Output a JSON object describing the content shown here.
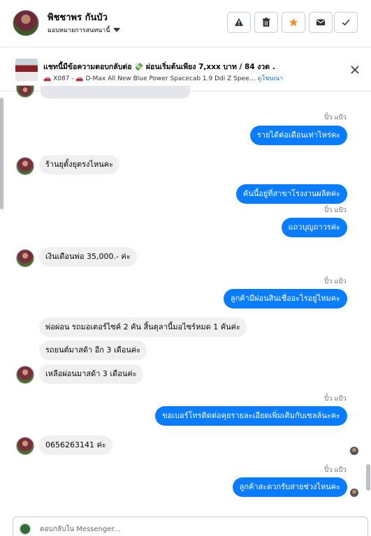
{
  "header": {
    "contact_name": "พิชชาพร กันบัว",
    "assign_label": "มอบหมายการสนทนานี้",
    "actions": [
      {
        "icon": "warning-icon"
      },
      {
        "icon": "trash-icon"
      },
      {
        "icon": "star-icon",
        "color": "#f28c28"
      },
      {
        "icon": "mail-icon"
      },
      {
        "icon": "check-icon"
      }
    ]
  },
  "ad_banner": {
    "title": "แชทนี้มีข้อความตอบกลับต่อ 💸 ผ่อนเริ่มต้นเพียง 7,xxx บาท / 84 งวด .",
    "subtitle": "🚗 X087 - 🚗 D-Max All New Blue Power Spacecab 1.9 Ddi Z Spee…",
    "link": "ดูโฆษณา"
  },
  "messages": [
    {
      "dir": "out",
      "sender": "ปิ๋ว แป้ว",
      "text": "รายได้ต่อเดือนเท่าไหร่คะ"
    },
    {
      "dir": "in",
      "text": "ร้านยุตั้งยุตรงไหนคะ"
    },
    {
      "dir": "out",
      "text": "คันนี้อยู่ที่สาขาโรงงานผลิตค่ะ"
    },
    {
      "dir": "out",
      "sender": "ปิ๋ว แป้ว",
      "text": "แถวบุญถาวรค่ะ"
    },
    {
      "dir": "in",
      "text": "เงินเดือนพ่อ 35,000.- ค่ะ"
    },
    {
      "dir": "out",
      "sender": "ปิ๋ว แป้ว",
      "text": "ลูกค้ามีผ่อนสินเชื่ออะไรอยู่ไหมคะ"
    },
    {
      "dir": "in",
      "text": "พ่อผ่อน รถมอเตอร์ไซค์ 2 คัน สิ้นตุลานี้มอไซร์หมด 1 คันค่ะ"
    },
    {
      "dir": "in",
      "text": "รถยนต์มาสด้า อีก 3 เดือนค่ะ"
    },
    {
      "dir": "in",
      "text": "เหลือผ่อนมาสด้า 3 เดือนค่ะ"
    },
    {
      "dir": "out",
      "sender": "ปิ๋ว แป้ว",
      "text": "ขอเบอร์โทรติดต่อคุยรายละเอียดเพิ่มเติมกับเซลล์นะคะ"
    },
    {
      "dir": "in",
      "text": "0656263141 ค่ะ"
    },
    {
      "dir": "out",
      "sender": "ปิ๋ว แป้ว",
      "text": "ลูกค้าสะดวกรับสายช่วงไหนคะ"
    }
  ],
  "composer": {
    "placeholder": "ตอบกลับใน Messenger..."
  }
}
